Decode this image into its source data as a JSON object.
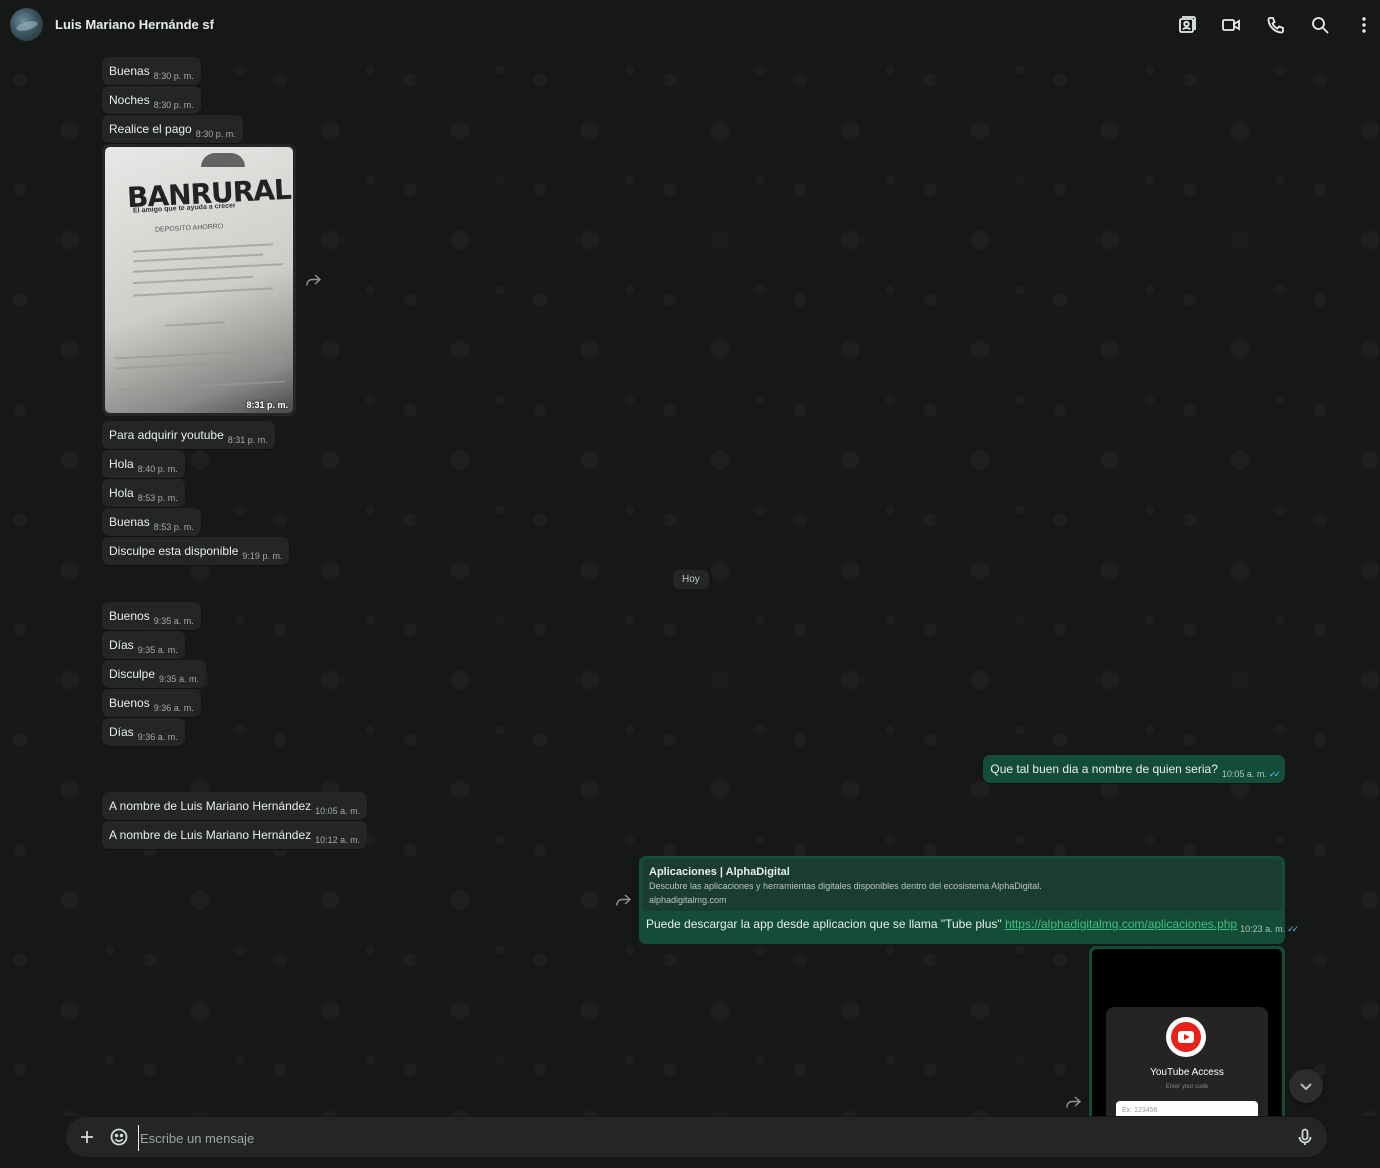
{
  "header": {
    "contact_name": "Luis Mariano Hernánde sf",
    "icons": [
      "contact-card-icon",
      "video-call-icon",
      "voice-call-icon",
      "search-icon",
      "more-options-icon"
    ]
  },
  "messages_in_early": [
    {
      "text": "Buenas",
      "time": "8:30 p. m."
    },
    {
      "text": "Noches",
      "time": "8:30 p. m."
    },
    {
      "text": "Realice el pago",
      "time": "8:30 p. m."
    }
  ],
  "image_message": {
    "receipt_brand": "BANRURAL",
    "receipt_slogan": "El amigo que te ayuda a crecer",
    "receipt_type": "DEPOSITO AHORRO",
    "time": "8:31 p. m."
  },
  "messages_in_late": [
    {
      "text": "Para adquirir youtube",
      "time": "8:31 p. m."
    },
    {
      "text": "Hola",
      "time": "8:40 p. m."
    },
    {
      "text": "Hola",
      "time": "8:53 p. m."
    },
    {
      "text": "Buenas",
      "time": "8:53 p. m."
    },
    {
      "text": "Disculpe esta disponible",
      "time": "9:19 p. m."
    }
  ],
  "day_separator": "Hoy",
  "messages_today": [
    {
      "text": "Buenos",
      "time": "9:35 a. m."
    },
    {
      "text": "Días",
      "time": "9:35 a. m."
    },
    {
      "text": "Disculpe",
      "time": "9:35 a. m."
    },
    {
      "text": "Buenos",
      "time": "9:36 a. m."
    },
    {
      "text": "Días",
      "time": "9:36 a. m."
    }
  ],
  "outgoing_question": {
    "text": "Que tal buen dia a nombre de quien seria?",
    "time": "10:05 a. m."
  },
  "replies": [
    {
      "text": "A nombre de Luis Mariano Hernández",
      "time": "10:05 a. m."
    },
    {
      "text": "A nombre de Luis Mariano Hernández",
      "time": "10:12 a. m."
    }
  ],
  "link_message": {
    "preview_title": "Aplicaciones | AlphaDigital",
    "preview_desc": "Descubre las aplicaciones y herramientas digitales disponibles dentro del ecosistema AlphaDigital.",
    "preview_domain": "alphadigitalmg.com",
    "text": "Puede descargar la app desde aplicacion que se llama \"Tube plus\" ",
    "link": "https://alphadigitalmg.com/aplicaciones.php",
    "time": "10:23 a. m."
  },
  "screenshot_message": {
    "app_title": "YouTube Access",
    "subtitle": "Enter your code",
    "input_placeholder": "Ex: 123456"
  },
  "composer": {
    "placeholder": "Escribe un mensaje"
  },
  "colors": {
    "background": "#161717",
    "incoming_bubble": "#242626",
    "outgoing_bubble": "#144d37",
    "read_ticks": "#53bdeb"
  }
}
